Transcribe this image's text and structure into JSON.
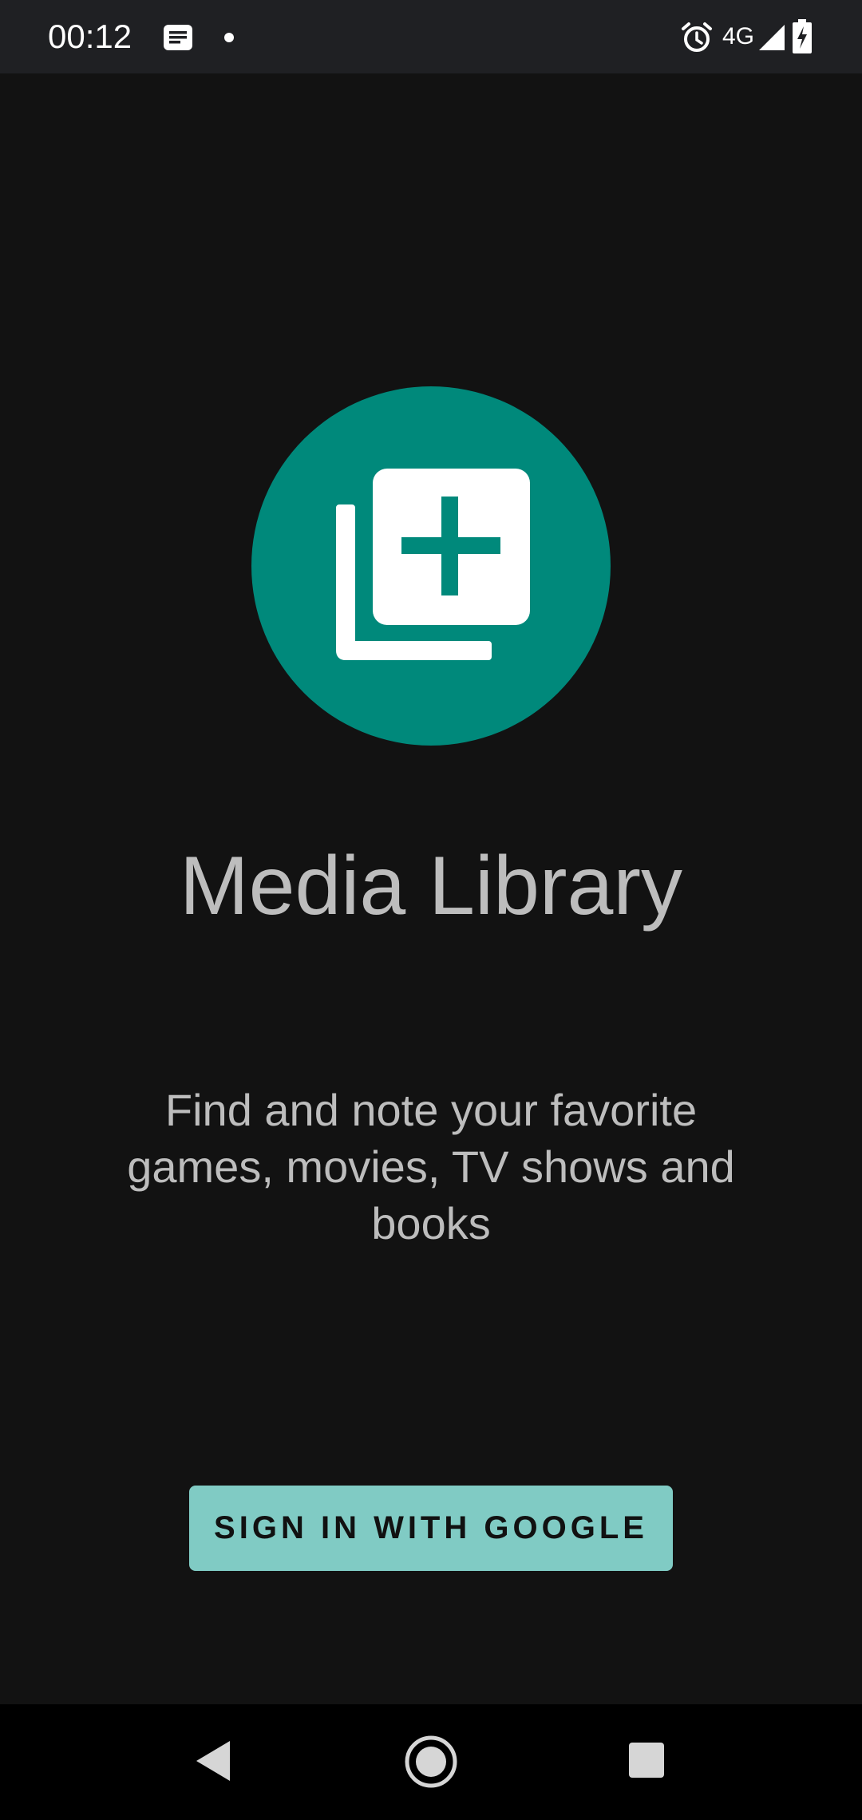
{
  "status_bar": {
    "time": "00:12",
    "network": "4G",
    "icons": [
      "message-notification-icon",
      "dot-icon",
      "alarm-icon",
      "signal-icon",
      "battery-charging-icon"
    ]
  },
  "app": {
    "title": "Media Library",
    "tagline": "Find and note your favorite games, movies, TV shows and books",
    "signin_label": "SIGN IN WITH GOOGLE",
    "logo_icon": "library-add-icon",
    "logo_color": "#00897b",
    "button_color": "#80cbc4"
  },
  "nav_bar": {
    "buttons": [
      "back-icon",
      "home-icon",
      "recents-icon"
    ]
  }
}
